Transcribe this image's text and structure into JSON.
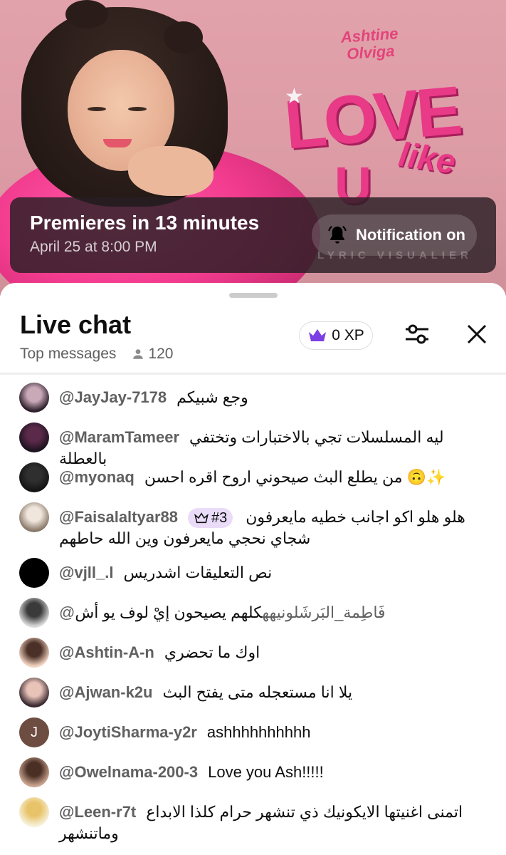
{
  "video": {
    "artist_logo": "Ashtine Olviga",
    "title_logo_love": "LOVE",
    "title_logo_like": "like",
    "title_logo_u": "U",
    "watermark": "LYRIC VISUALIER",
    "premiere_title": "Premieres in 13 minutes",
    "premiere_date": "April 25 at 8:00 PM",
    "notification_label": "Notification on"
  },
  "chat": {
    "title": "Live chat",
    "filter_label": "Top messages",
    "viewer_count": "120",
    "xp_label": "0 XP",
    "messages": [
      {
        "author": "@JayJay-7178",
        "text": "وجع شبيكم",
        "avatar_colors": [
          "#2c1f2b",
          "#c9a8b8"
        ]
      },
      {
        "author": "@MaramTameer",
        "text": "ليه المسلسلات تجي بالاختبارات وتختفي بالعطلة",
        "avatar_colors": [
          "#1d1320",
          "#5b2a4a"
        ]
      },
      {
        "author": "@myonaq",
        "text": "من يطلع البث صيحوني اروح اقره احسن 🙃✨",
        "avatar_colors": [
          "#141414",
          "#2f2f2f"
        ]
      },
      {
        "author": "@Faisalaltyar88",
        "badge": "#3",
        "text": "هلو هلو اكو اجانب خطيه مايعرفون شجاي نحجي مايعرفون وين الله حاطهم",
        "avatar_colors": [
          "#8a7a6a",
          "#f0e6dc"
        ]
      },
      {
        "author": "@vjll_.l",
        "text": "نص التعليقات اشدريس",
        "avatar_colors": [
          "#000000",
          "#000000"
        ]
      },
      {
        "author": "",
        "mention": "@فَاطِمة_البَرشَلونيهه",
        "text": "كلهم يصيحون إيْ لوف يو أش",
        "avatar_colors": [
          "#d8d8d8",
          "#3a3a3a"
        ]
      },
      {
        "author": "@Ashtin-A-n",
        "text": "اوك ما تحضري",
        "avatar_colors": [
          "#f2d2c0",
          "#4a3026"
        ]
      },
      {
        "author": "@Ajwan-k2u",
        "text": "يلا انا مستعجله متى يفتح البث",
        "avatar_colors": [
          "#3a2a30",
          "#e8c3b8"
        ]
      },
      {
        "author": "@JoytiSharma-y2r",
        "text": "ashhhhhhhhhh",
        "avatar_letter": "J",
        "avatar_colors": [
          "#6d4c41",
          "#6d4c41"
        ]
      },
      {
        "author": "@Owelnama-200-3",
        "text": "Love you Ash!!!!!",
        "avatar_colors": [
          "#c9a38f",
          "#4a2f25"
        ]
      },
      {
        "author": "@Leen-r7t",
        "text": "اتمنى اغنيتها الايكونيك ذي تنشهر حرام كلذا الابداع وماتنشهر",
        "avatar_colors": [
          "#f6f0d8",
          "#e9c36a"
        ]
      }
    ]
  },
  "colors": {
    "accent_purple": "#7b3fe4",
    "badge_bg": "#eadcf9",
    "author_gray": "#606060"
  }
}
